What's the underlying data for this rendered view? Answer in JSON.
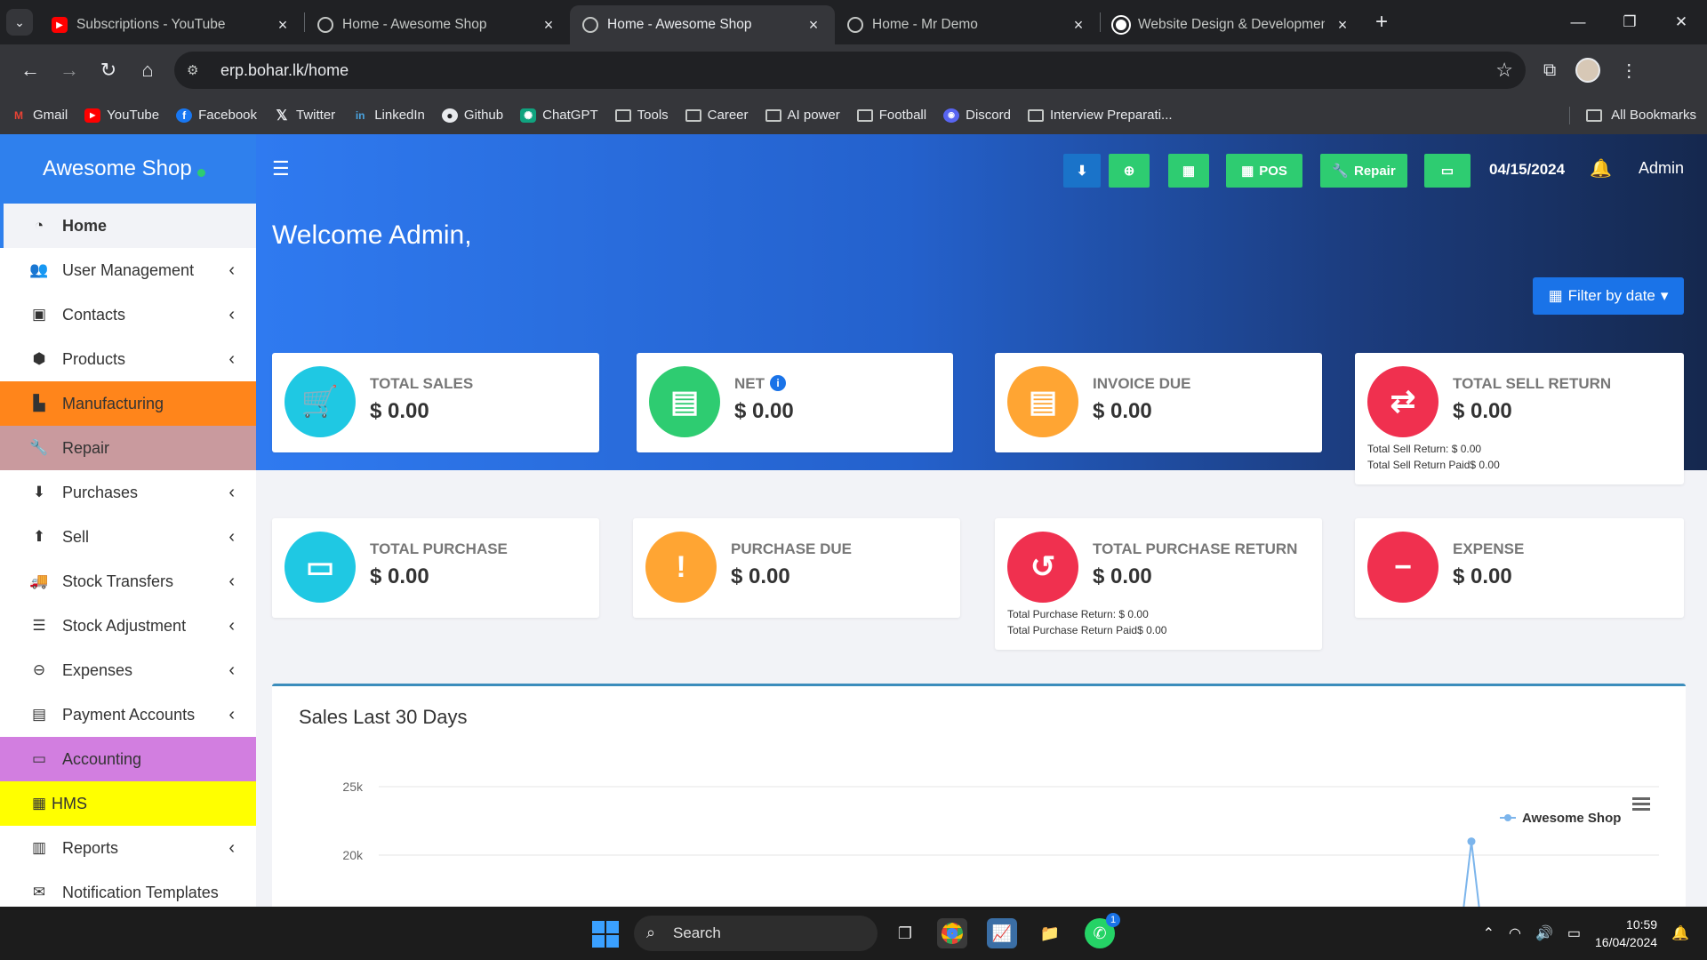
{
  "browser": {
    "tabs": [
      {
        "title": "Subscriptions - YouTube",
        "active": false
      },
      {
        "title": "Home - Awesome Shop",
        "active": false
      },
      {
        "title": "Home - Awesome Shop",
        "active": true
      },
      {
        "title": "Home - Mr Demo",
        "active": false
      },
      {
        "title": "Website Design & Developmen",
        "active": false
      }
    ],
    "url": "erp.bohar.lk/home",
    "bookmarks": [
      "Gmail",
      "YouTube",
      "Facebook",
      "Twitter",
      "LinkedIn",
      "Github",
      "ChatGPT",
      "Tools",
      "Career",
      "AI power",
      "Football",
      "Discord",
      "Interview Preparati..."
    ],
    "all_bookmarks": "All Bookmarks"
  },
  "app": {
    "brand": "Awesome Shop",
    "date": "04/15/2024",
    "user": "Admin",
    "welcome": "Welcome Admin,",
    "filter_label": "Filter by date",
    "buttons": {
      "pos": "POS",
      "repair": "Repair"
    }
  },
  "sidebar": {
    "items": [
      {
        "label": "Home",
        "icon": "dashboard-icon",
        "chevron": false
      },
      {
        "label": "User Management",
        "icon": "users-icon",
        "chevron": true
      },
      {
        "label": "Contacts",
        "icon": "address-book-icon",
        "chevron": true
      },
      {
        "label": "Products",
        "icon": "cubes-icon",
        "chevron": true
      },
      {
        "label": "Manufacturing",
        "icon": "industry-icon",
        "chevron": false
      },
      {
        "label": "Repair",
        "icon": "wrench-icon",
        "chevron": false
      },
      {
        "label": "Purchases",
        "icon": "arrow-circle-down-icon",
        "chevron": true
      },
      {
        "label": "Sell",
        "icon": "arrow-circle-up-icon",
        "chevron": true
      },
      {
        "label": "Stock Transfers",
        "icon": "truck-icon",
        "chevron": true
      },
      {
        "label": "Stock Adjustment",
        "icon": "database-icon",
        "chevron": true
      },
      {
        "label": "Expenses",
        "icon": "minus-circle-icon",
        "chevron": true
      },
      {
        "label": "Payment Accounts",
        "icon": "money-icon",
        "chevron": true
      },
      {
        "label": "Accounting",
        "icon": "credit-card-icon",
        "chevron": false
      },
      {
        "label": "HMS",
        "icon": "building-icon",
        "chevron": false
      },
      {
        "label": "Reports",
        "icon": "bar-chart-icon",
        "chevron": true
      },
      {
        "label": "Notification Templates",
        "icon": "envelope-icon",
        "chevron": false
      }
    ]
  },
  "cards": {
    "total_sales": {
      "label": "TOTAL SALES",
      "value": "$ 0.00",
      "color": "#1fc8e3"
    },
    "net": {
      "label": "NET",
      "value": "$ 0.00",
      "color": "#2ecc71"
    },
    "invoice_due": {
      "label": "INVOICE DUE",
      "value": "$ 0.00",
      "color": "#ffa533"
    },
    "total_sell_return": {
      "label": "TOTAL SELL RETURN",
      "value": "$ 0.00",
      "color": "#f0304f",
      "sub1": "Total Sell Return: $ 0.00",
      "sub2": "Total Sell Return Paid$ 0.00"
    },
    "total_purchase": {
      "label": "TOTAL PURCHASE",
      "value": "$ 0.00",
      "color": "#1fc8e3"
    },
    "purchase_due": {
      "label": "PURCHASE DUE",
      "value": "$ 0.00",
      "color": "#ffa533"
    },
    "total_purchase_return": {
      "label": "TOTAL PURCHASE RETURN",
      "value": "$ 0.00",
      "color": "#f0304f",
      "sub1": "Total Purchase Return: $ 0.00",
      "sub2": "Total Purchase Return Paid$ 0.00"
    },
    "expense": {
      "label": "EXPENSE",
      "value": "$ 0.00",
      "color": "#f0304f"
    }
  },
  "chart_data": {
    "type": "line",
    "title": "Sales Last 30 Days",
    "yticks": [
      "25k",
      "20k"
    ],
    "series": [
      {
        "name": "Awesome Shop",
        "color": "#7cb5ec",
        "peak": 21000
      }
    ]
  },
  "taskbar": {
    "search": "Search",
    "time": "10:59",
    "date": "16/04/2024",
    "whatsapp_badge": "1"
  }
}
